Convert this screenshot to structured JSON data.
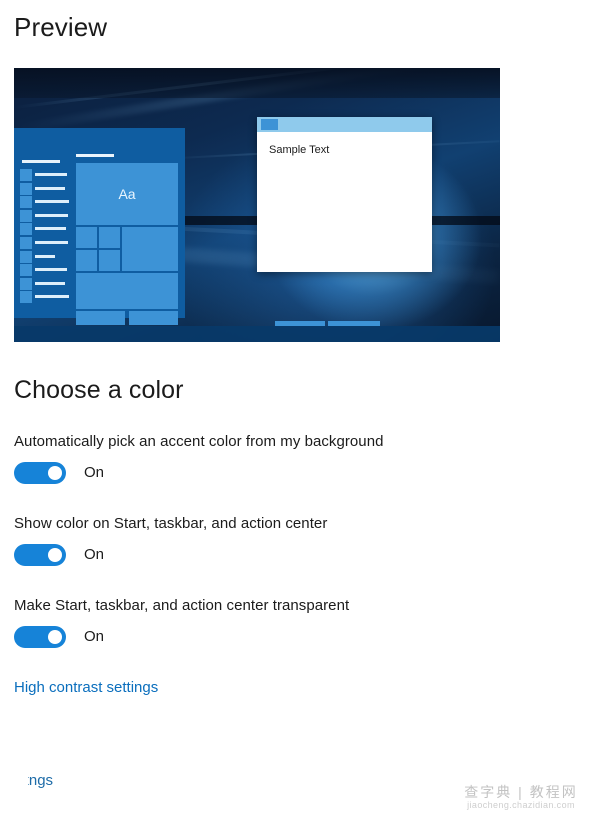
{
  "page": {
    "preview_heading": "Preview",
    "section_heading": "Choose a color"
  },
  "preview": {
    "sample_window": {
      "title_icon": "app-icon",
      "body_text": "Sample Text"
    },
    "start_menu": {
      "tile_label": "Aa"
    }
  },
  "settings": [
    {
      "label": "Automatically pick an accent color from my background",
      "state": "On",
      "enabled": true
    },
    {
      "label": "Show color on Start, taskbar, and action center",
      "state": "On",
      "enabled": true
    },
    {
      "label": "Make Start, taskbar, and action center transparent",
      "state": "On",
      "enabled": true
    }
  ],
  "links": {
    "high_contrast": "High contrast settings",
    "cut_off_bottom": "ontngs"
  },
  "watermark": {
    "top": "查字典 | 教程网",
    "bottom": "jiaocheng.chazidian.com"
  },
  "colors": {
    "accent": "#1683d8",
    "link": "#0a6ebd",
    "start_menu": "#0f5da1",
    "tile": "#3d93d6",
    "text": "#1b1b1b"
  }
}
